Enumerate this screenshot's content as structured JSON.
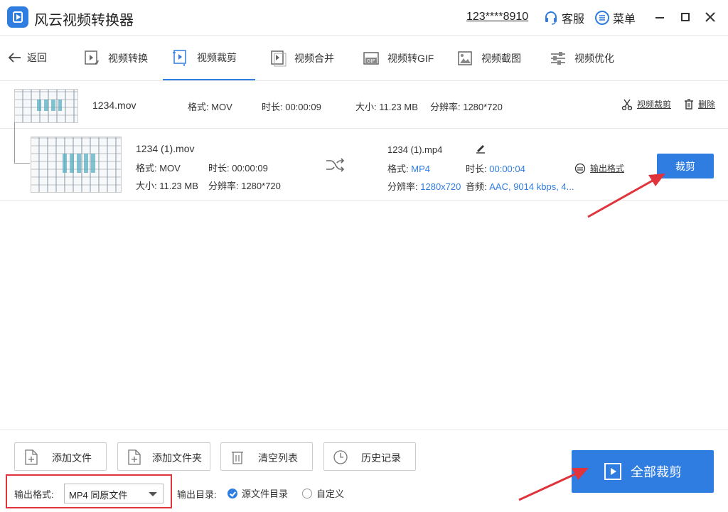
{
  "app": {
    "title": "风云视频转换器",
    "account": "123****8910",
    "service_label": "客服",
    "menu_label": "菜单"
  },
  "nav": {
    "back_label": "返回",
    "tabs": [
      {
        "label": "视频转换",
        "icon": "video-convert-icon"
      },
      {
        "label": "视频裁剪",
        "icon": "video-crop-icon",
        "active": true
      },
      {
        "label": "视频合并",
        "icon": "video-merge-icon"
      },
      {
        "label": "视频转GIF",
        "icon": "gif-icon"
      },
      {
        "label": "视频截图",
        "icon": "screenshot-icon"
      },
      {
        "label": "视频优化",
        "icon": "optimize-icon"
      }
    ]
  },
  "source_file": {
    "name": "1234.mov",
    "format": "格式: MOV",
    "duration": "时长: 00:00:09",
    "size": "大小: 11.23 MB",
    "resolution": "分辨率: 1280*720",
    "crop_link": "视频裁剪",
    "delete_link": "删除"
  },
  "task": {
    "input": {
      "name": "1234 (1).mov",
      "format": "格式: MOV",
      "duration": "时长: 00:00:09",
      "size": "大小: 11.23 MB",
      "resolution": "分辨率: 1280*720"
    },
    "output": {
      "name": "1234 (1).mp4",
      "format_label": "格式:",
      "format_value": "MP4",
      "duration_label": "时长:",
      "duration_value": "00:00:04",
      "resolution_label": "分辨率:",
      "resolution_value": "1280x720",
      "audio_label": "音频:",
      "audio_value": "AAC, 9014 kbps, 4..."
    },
    "output_format_link": "输出格式",
    "crop_button": "裁剪"
  },
  "bottom": {
    "add_file": "添加文件",
    "add_folder": "添加文件夹",
    "clear_list": "清空列表",
    "history": "历史记录",
    "format_label": "输出格式:",
    "format_value": "MP4 同原文件",
    "dir_label": "输出目录:",
    "dir_source": "源文件目录",
    "dir_custom": "自定义",
    "crop_all": "全部裁剪"
  },
  "colors": {
    "accent": "#2f7de1",
    "highlight": "#e0343c"
  }
}
